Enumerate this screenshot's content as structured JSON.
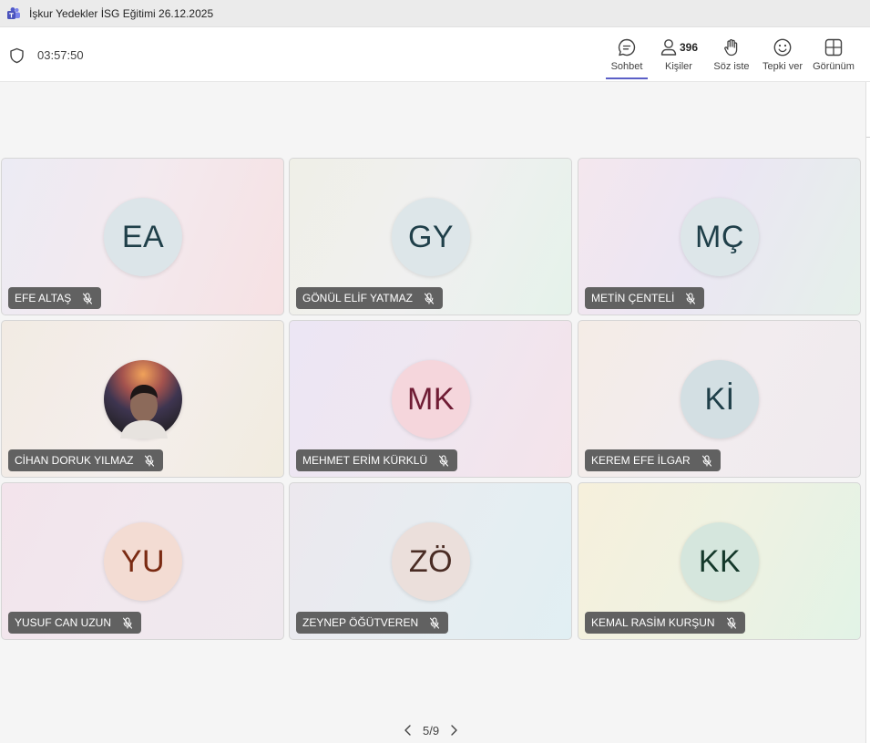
{
  "window": {
    "title": "İşkur Yedekler İSG Eğitimi 26.12.2025"
  },
  "meeting": {
    "duration": "03:57:50"
  },
  "toolbar": {
    "chat_label": "Sohbet",
    "people_label": "Kişiler",
    "people_count": "396",
    "raise_hand_label": "Söz iste",
    "react_label": "Tepki ver",
    "view_label": "Görünüm"
  },
  "participants": [
    {
      "name": "EFE ALTAŞ",
      "initials": "EA"
    },
    {
      "name": "GÖNÜL ELİF YATMAZ",
      "initials": "GY"
    },
    {
      "name": "METİN ÇENTELİ",
      "initials": "MÇ"
    },
    {
      "name": "CİHAN DORUK YILMAZ",
      "initials": ""
    },
    {
      "name": "MEHMET ERİM KÜRKLÜ",
      "initials": "MK"
    },
    {
      "name": "KEREM EFE İLGAR",
      "initials": "Kİ"
    },
    {
      "name": "YUSUF CAN UZUN",
      "initials": "YU"
    },
    {
      "name": "ZEYNEP ÖĞÜTVEREN",
      "initials": "ZÖ"
    },
    {
      "name": "KEMAL RASİM KURŞUN",
      "initials": "KK"
    }
  ],
  "pagination": {
    "text": "5/9"
  },
  "icons": [
    "teams-app-icon",
    "shield-icon",
    "chat-icon",
    "people-icon",
    "raise-hand-icon",
    "emoji-icon",
    "layout-grid-icon",
    "mic-off-icon",
    "chevron-left-icon",
    "chevron-right-icon"
  ],
  "colors": {
    "accent": "#5b5fc7",
    "nametag_bg": "#616161"
  }
}
